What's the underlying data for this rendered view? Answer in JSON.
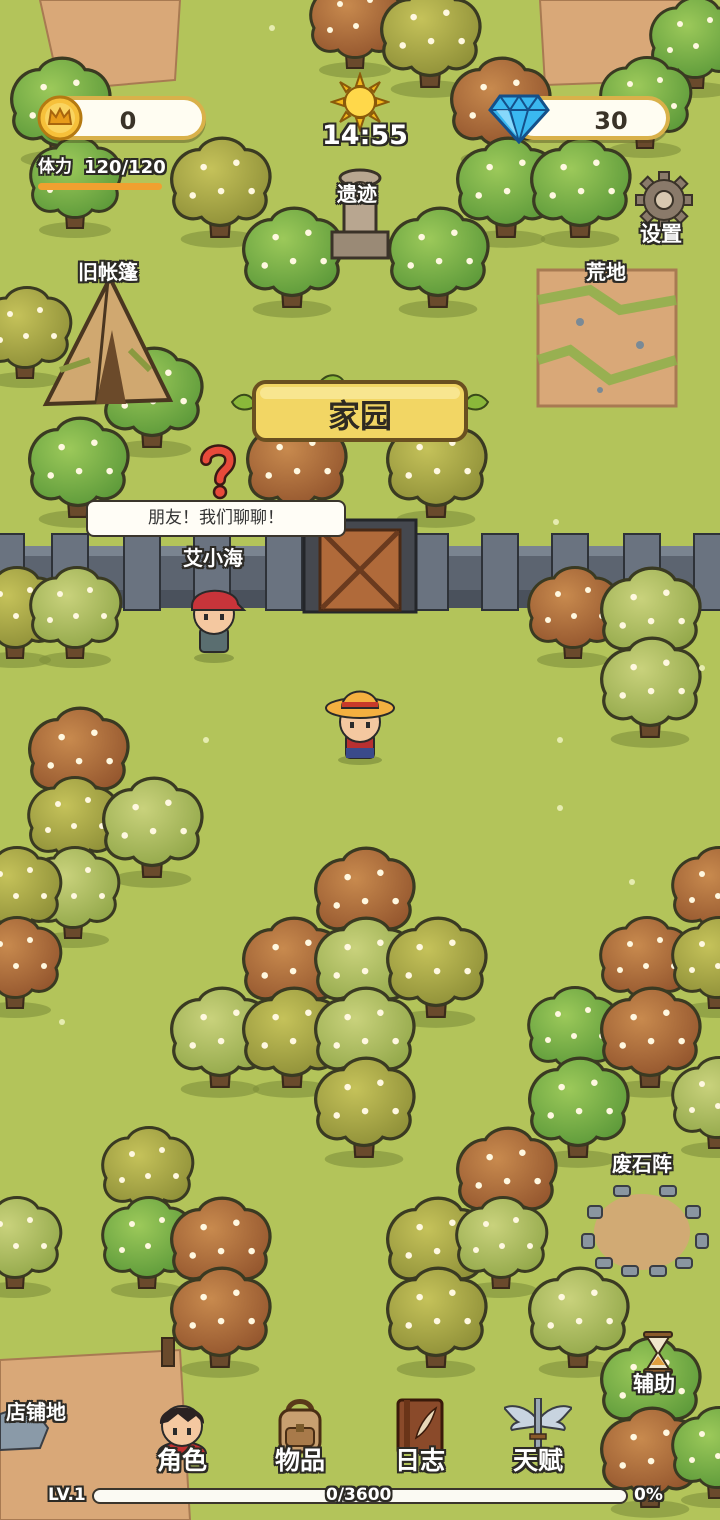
{
  "hud": {
    "gold": "0",
    "gems": "30",
    "stamina_label": "体力",
    "stamina_value": "120/120",
    "stamina_fraction": 1.0,
    "clock": "14:55",
    "settings_label": "设置"
  },
  "places": {
    "ruins": "遗迹",
    "tent": "旧帐篷",
    "wasteland": "荒地",
    "home": "家园",
    "stone_ring": "废石阵",
    "shop": "店铺地"
  },
  "npc": {
    "name": "艾小海",
    "speech": "朋友！我们聊聊！"
  },
  "nav": {
    "character": "角色",
    "items": "物品",
    "journal": "日志",
    "talent": "天赋",
    "assist": "辅助"
  },
  "progress": {
    "level": "LV.1",
    "xp": "0/3600",
    "percent": "0%",
    "fraction": 0
  },
  "colors": {
    "grass": "#b3c45a",
    "wall": "#5c6470",
    "banner": "#f2d664",
    "pill_border": "#d9b14a"
  }
}
